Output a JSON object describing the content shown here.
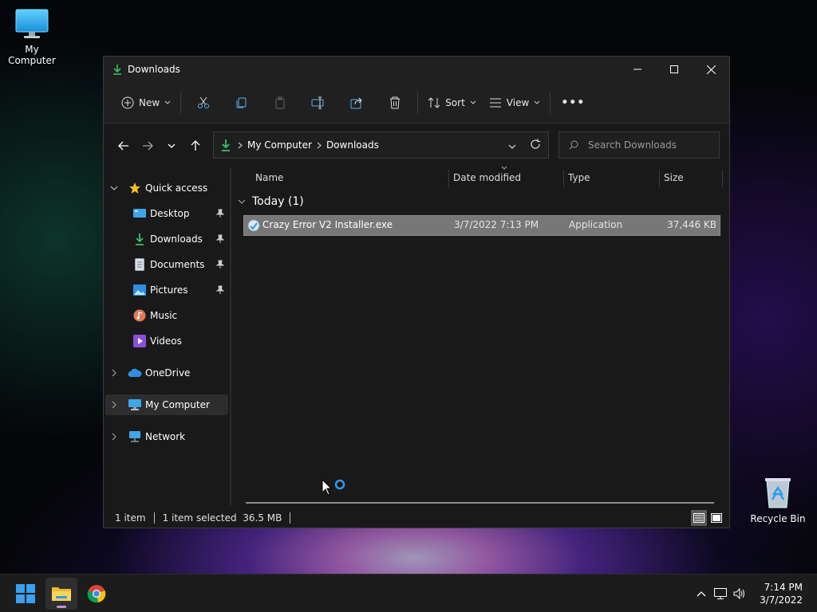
{
  "desktop": {
    "icons": [
      {
        "label": "My Computer",
        "icon": "monitor-icon"
      },
      {
        "label": "Recycle Bin",
        "icon": "recycle-bin-icon"
      }
    ]
  },
  "window": {
    "title": "Downloads",
    "toolbar": {
      "new_label": "New",
      "sort_label": "Sort",
      "view_label": "View",
      "more_label": "•••"
    },
    "address": {
      "crumbs": [
        "My Computer",
        "Downloads"
      ]
    },
    "search": {
      "placeholder": "Search Downloads"
    },
    "sidebar": {
      "quick_access": "Quick access",
      "items": [
        {
          "label": "Desktop",
          "pinned": true
        },
        {
          "label": "Downloads",
          "pinned": true
        },
        {
          "label": "Documents",
          "pinned": true
        },
        {
          "label": "Pictures",
          "pinned": true
        },
        {
          "label": "Music",
          "pinned": false
        },
        {
          "label": "Videos",
          "pinned": false
        }
      ],
      "onedrive": "OneDrive",
      "my_computer": "My Computer",
      "network": "Network"
    },
    "columns": {
      "name": "Name",
      "date": "Date modified",
      "type": "Type",
      "size": "Size"
    },
    "group": {
      "label": "Today (1)"
    },
    "files": [
      {
        "name": "Crazy Error V2 Installer.exe",
        "date": "3/7/2022 7:13 PM",
        "type": "Application",
        "size": "37,446 KB"
      }
    ],
    "status": {
      "count": "1 item",
      "selected": "1 item selected  36.5 MB"
    }
  },
  "taskbar": {
    "clock_time": "7:14 PM",
    "clock_date": "3/7/2022"
  },
  "colors": {
    "accent": "#2e9bf0",
    "download_green": "#3dbf6a",
    "selection": "#777777"
  }
}
